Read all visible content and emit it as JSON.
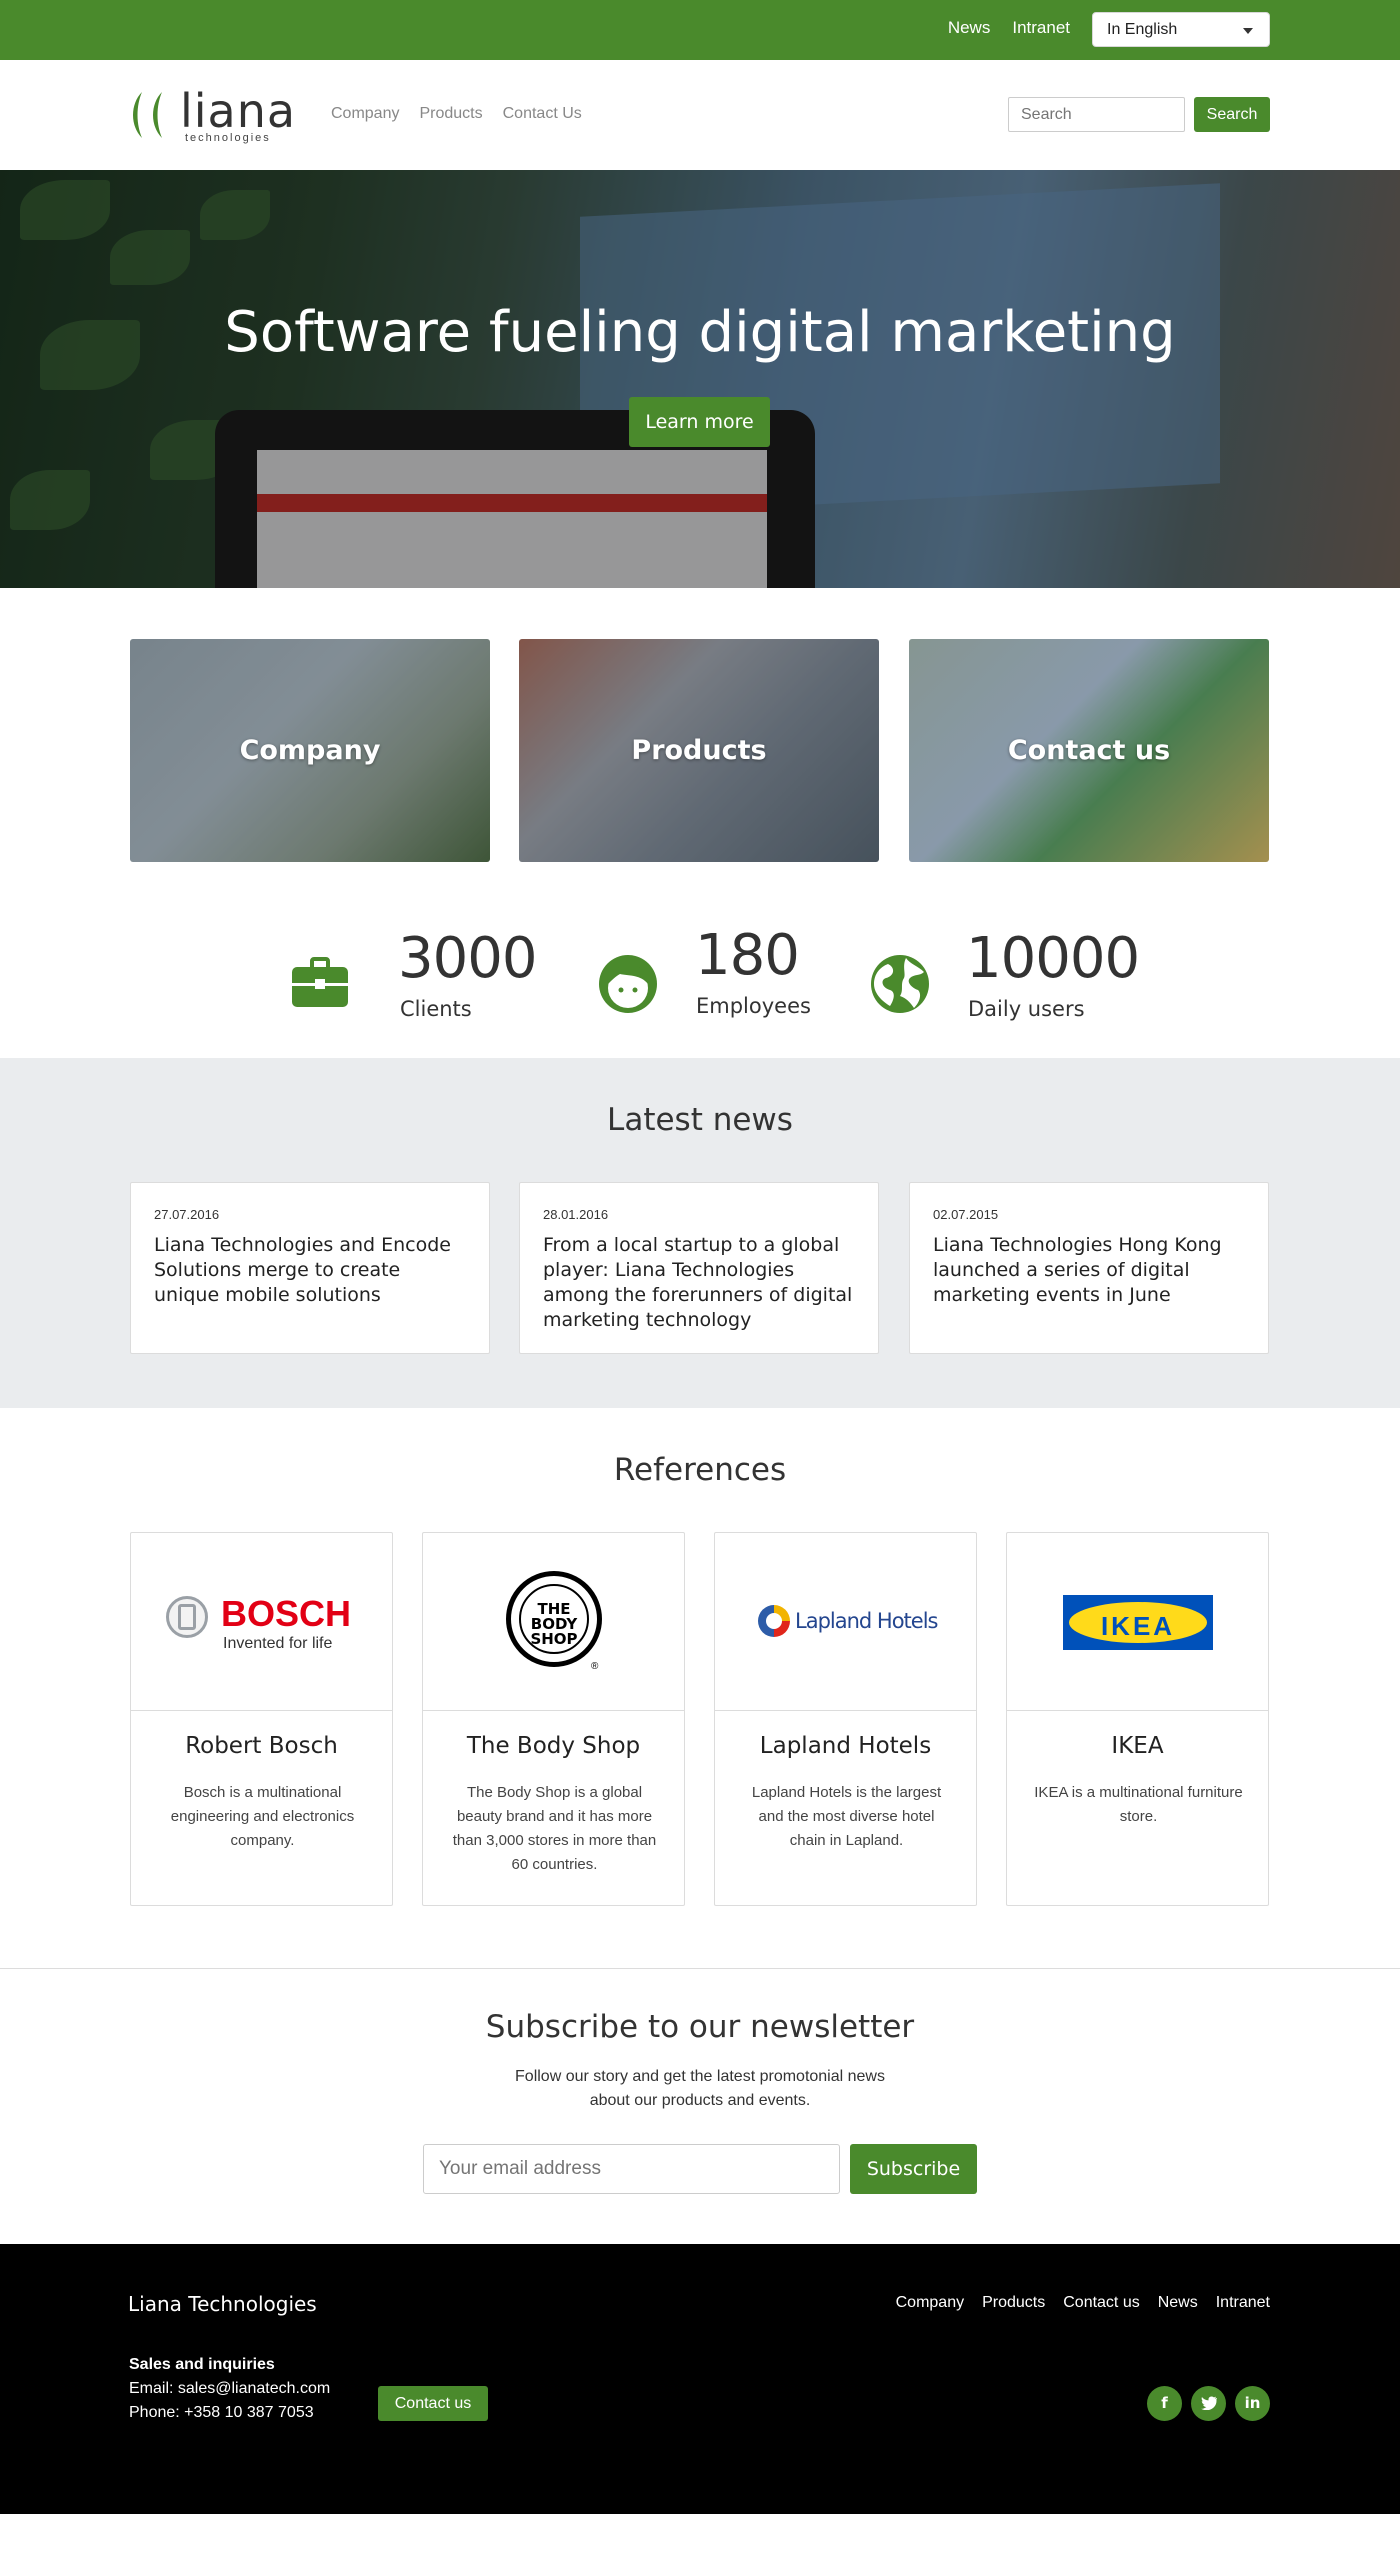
{
  "topbar": {
    "news_link": "News",
    "intranet_link": "Intranet",
    "language": "In English"
  },
  "nav": {
    "logo_word": "liana",
    "logo_sub": "technologies",
    "items": [
      "Company",
      "Products",
      "Contact Us"
    ],
    "search_placeholder": "Search",
    "search_button": "Search"
  },
  "hero": {
    "title": "Software fueling digital marketing",
    "button": "Learn more"
  },
  "tiles": [
    "Company",
    "Products",
    "Contact us"
  ],
  "stats": [
    {
      "value": "3000",
      "label": "Clients",
      "icon": "briefcase-icon"
    },
    {
      "value": "180",
      "label": "Employees",
      "icon": "face-icon"
    },
    {
      "value": "10000",
      "label": "Daily users",
      "icon": "globe-icon"
    }
  ],
  "news": {
    "heading": "Latest news",
    "items": [
      {
        "date": "27.07.2016",
        "title": "Liana Technologies and Encode Solutions merge to create unique mobile solutions"
      },
      {
        "date": "28.01.2016",
        "title": "From a local startup to a global player: Liana Technologies among the forerunners of digital marketing technology"
      },
      {
        "date": "02.07.2015",
        "title": "Liana Technologies Hong Kong launched a series of digital marketing events in June"
      }
    ]
  },
  "references": {
    "heading": "References",
    "items": [
      {
        "name": "Robert Bosch",
        "desc": "Bosch is a multinational engineering and electronics company.",
        "logo_text": "BOSCH",
        "logo_tagline": "Invented for life"
      },
      {
        "name": "The Body Shop",
        "desc": "The Body Shop is a global beauty brand and it has more than 3,000 stores in more than 60 countries.",
        "logo_text": "THE BODY SHOP"
      },
      {
        "name": "Lapland Hotels",
        "desc": "Lapland Hotels is the largest and the most diverse hotel chain in Lapland.",
        "logo_text": "Lapland Hotels"
      },
      {
        "name": "IKEA",
        "desc": "IKEA is a multinational furniture store.",
        "logo_text": "IKEA"
      }
    ]
  },
  "newsletter": {
    "heading": "Subscribe to our newsletter",
    "desc": "Follow our story and get the latest promotonial news about our products and events.",
    "email_placeholder": "Your email address",
    "button": "Subscribe"
  },
  "footer": {
    "brand": "Liana Technologies",
    "links": [
      "Company",
      "Products",
      "Contact us",
      "News",
      "Intranet"
    ],
    "sales_heading": "Sales and inquiries",
    "email": "Email: sales@lianatech.com",
    "phone": "Phone: +358 10 387 7053",
    "contact_button": "Contact us",
    "social": [
      "f",
      "t",
      "in"
    ]
  },
  "colors": {
    "brand_green": "#4a8a2c",
    "footer_bg": "#000000",
    "news_bg": "#eaecee"
  }
}
